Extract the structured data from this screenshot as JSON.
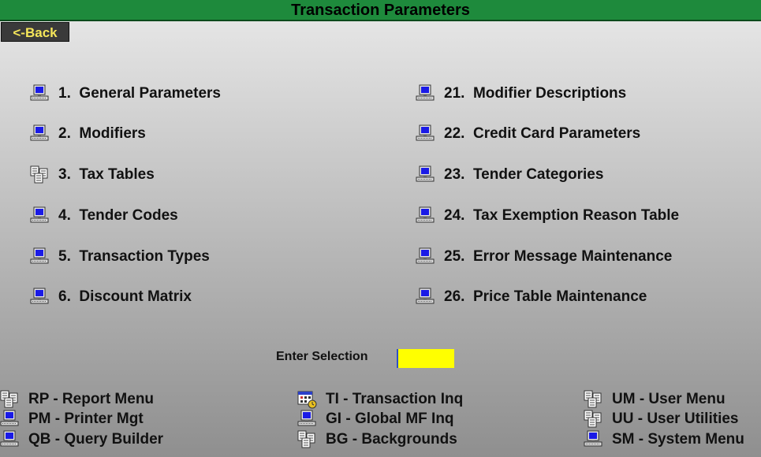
{
  "window": {
    "title": "Transaction Parameters"
  },
  "nav": {
    "back_label": "<-Back"
  },
  "menu": {
    "left": [
      {
        "num": "1.",
        "label": "General Parameters",
        "icon": "computer-icon"
      },
      {
        "num": "2.",
        "label": "Modifiers",
        "icon": "computer-icon"
      },
      {
        "num": "3.",
        "label": "Tax Tables",
        "icon": "documents-icon"
      },
      {
        "num": "4.",
        "label": "Tender Codes",
        "icon": "computer-icon"
      },
      {
        "num": "5.",
        "label": "Transaction Types",
        "icon": "computer-icon"
      },
      {
        "num": "6.",
        "label": "Discount Matrix",
        "icon": "computer-icon"
      }
    ],
    "right": [
      {
        "num": "21.",
        "label": "Modifier Descriptions",
        "icon": "computer-icon"
      },
      {
        "num": "22.",
        "label": "Credit Card Parameters",
        "icon": "computer-icon"
      },
      {
        "num": "23.",
        "label": "Tender Categories",
        "icon": "computer-icon"
      },
      {
        "num": "24.",
        "label": "Tax Exemption Reason Table",
        "icon": "computer-icon"
      },
      {
        "num": "25.",
        "label": "Error Message Maintenance",
        "icon": "computer-icon"
      },
      {
        "num": "26.",
        "label": "Price Table Maintenance",
        "icon": "computer-icon"
      }
    ]
  },
  "selection": {
    "label": "Enter Selection",
    "value": ""
  },
  "shortcuts": [
    {
      "label": "RP - Report Menu",
      "icon": "documents-icon"
    },
    {
      "label": "PM - Printer Mgt",
      "icon": "computer-icon"
    },
    {
      "label": "QB - Query Builder",
      "icon": "computer-icon"
    },
    {
      "label": "TI - Transaction Inq",
      "icon": "calendar-icon"
    },
    {
      "label": "GI - Global MF Inq",
      "icon": "computer-icon"
    },
    {
      "label": "BG - Backgrounds",
      "icon": "documents-icon"
    },
    {
      "label": "UM - User Menu",
      "icon": "documents-icon"
    },
    {
      "label": "UU - User Utilities",
      "icon": "documents-icon"
    },
    {
      "label": "SM - System Menu",
      "icon": "computer-icon"
    }
  ],
  "colors": {
    "title_bar": "#1e8a3c",
    "back_text": "#f5e65a",
    "input_bg": "#ffff00",
    "screen_blue": "#1a1ae6"
  }
}
